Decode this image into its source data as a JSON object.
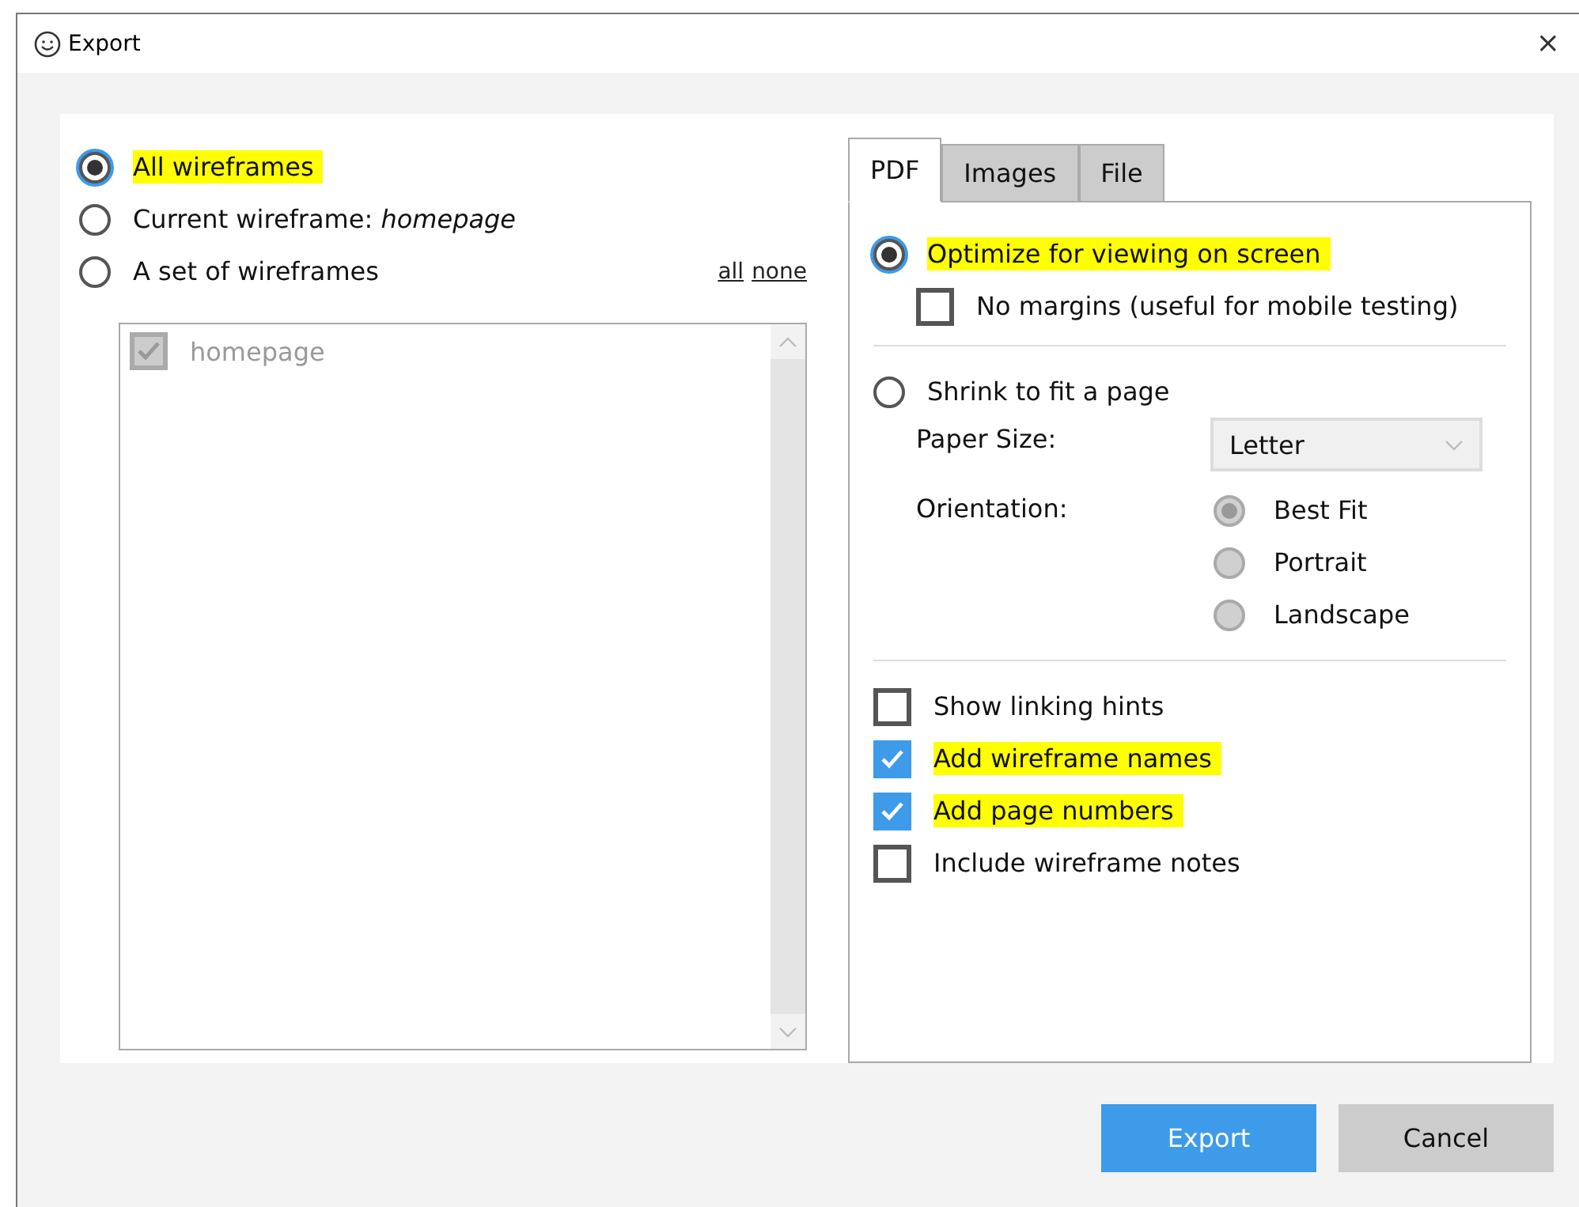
{
  "window": {
    "title": "Export",
    "close": "×"
  },
  "scope": {
    "options": [
      {
        "label": "All wireframes",
        "selected": true,
        "highlighted": true
      },
      {
        "label": "Current wireframe: *homepage*",
        "selected": false,
        "highlighted": false
      },
      {
        "label": "A set of wireframes",
        "selected": false,
        "highlighted": false
      }
    ],
    "links": [
      "all",
      "none"
    ],
    "list": [
      {
        "label": "homepage",
        "checked": true,
        "disabled": true
      }
    ]
  },
  "tabs": [
    {
      "label": "PDF",
      "selected": true
    },
    {
      "label": "Images",
      "selected": false
    },
    {
      "label": "File",
      "selected": false
    }
  ],
  "pdf": {
    "optimize": {
      "label": "Optimize for viewing on screen",
      "selected": true,
      "highlighted": true
    },
    "no_margins": {
      "label": "No margins (useful for mobile testing)",
      "checked": false
    },
    "shrink": {
      "label": "Shrink to fit a page",
      "selected": false
    },
    "paper_size": {
      "label": "Paper Size:",
      "value": "Letter"
    },
    "orientation": {
      "label": "Orientation:",
      "options": [
        {
          "label": "Best Fit",
          "selected": true,
          "disabled": true
        },
        {
          "label": "Portrait",
          "selected": false,
          "disabled": true
        },
        {
          "label": "Landscape",
          "selected": false,
          "disabled": true
        }
      ]
    },
    "checks": [
      {
        "label": "Show linking hints",
        "checked": false,
        "highlighted": false
      },
      {
        "label": "Add wireframe names",
        "checked": true,
        "highlighted": true
      },
      {
        "label": "Add page numbers",
        "checked": true,
        "highlighted": true
      },
      {
        "label": "Include wireframe notes",
        "checked": false,
        "highlighted": false
      }
    ]
  },
  "buttons": [
    {
      "label": "Export",
      "kind": "primary"
    },
    {
      "label": "Cancel",
      "kind": "secondary"
    }
  ]
}
